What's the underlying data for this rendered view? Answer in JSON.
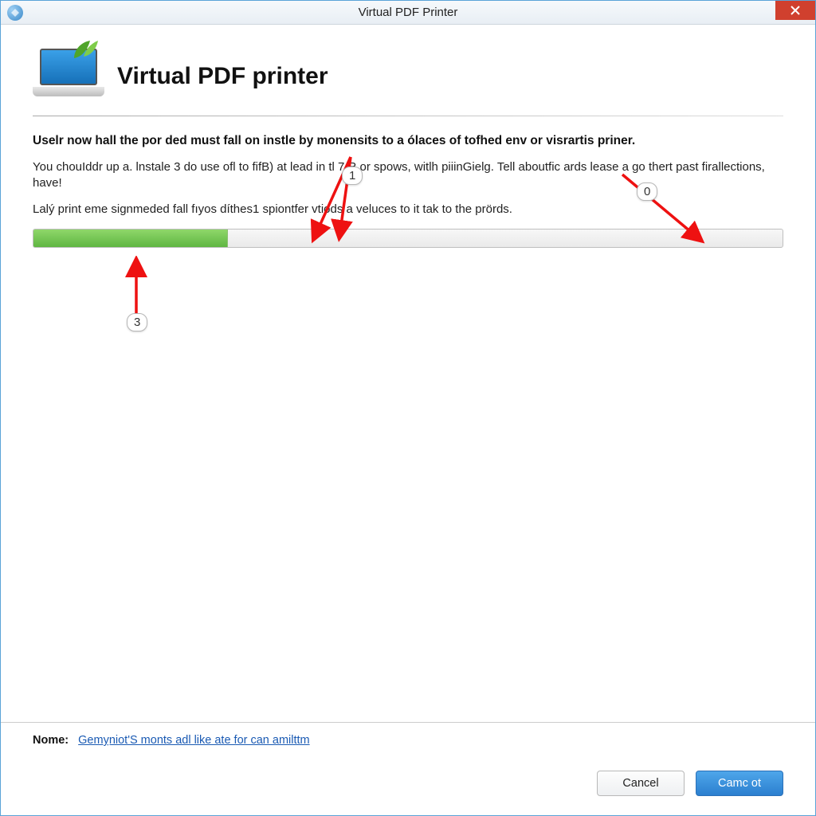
{
  "window": {
    "title": "Virtual PDF Printer"
  },
  "header": {
    "heading": "Virtual PDF printer"
  },
  "body": {
    "bold_line": "Uselr now hall the por ded must fall on instle by monensits to a ólaces of tofhed env or visrartis priner.",
    "para1": "You chouIddr up a. lnstale 3 do use ofl to fifB) at lead in tl  7/R or spows, witlh piiinGielg. Tell aboutfic ards lease a go thert past firallections, have!",
    "para2": "Lalý print eme signmeded fall fıyos díthes1 spiontfer vtiods a veluces to it tak to the prörds."
  },
  "progress": {
    "percent": 26
  },
  "callouts": {
    "c1": "1",
    "c2": "0",
    "c3": "3"
  },
  "footer": {
    "nome_label": "Nome:",
    "nome_link": "Gemỵniot'S monts adl like ate for can amilttm",
    "cancel": "Cancel",
    "primary": "Camc ot"
  }
}
